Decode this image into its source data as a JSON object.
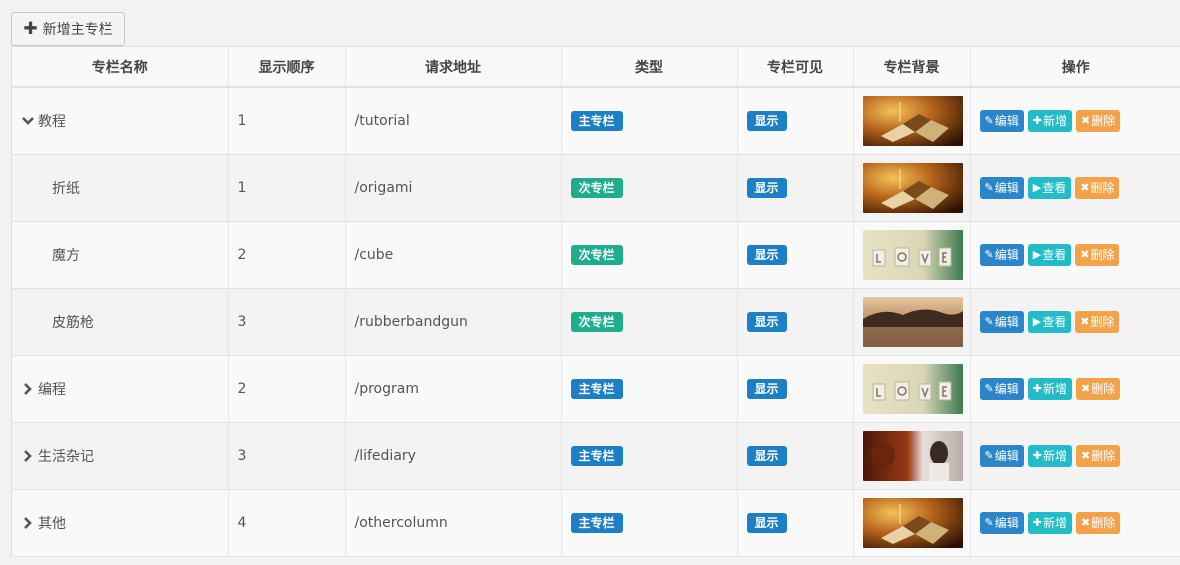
{
  "toolbar": {
    "add_main_label": "新增主专栏"
  },
  "columns": [
    "专栏名称",
    "显示顺序",
    "请求地址",
    "类型",
    "专栏可见",
    "专栏背景",
    "操作"
  ],
  "rows": [
    {
      "name": "教程",
      "order": "1",
      "url": "/tutorial",
      "type": "主专栏",
      "type_kind": "main",
      "visible": "显示",
      "bg": "book",
      "level": "parent",
      "caret": "down",
      "action2": "新增"
    },
    {
      "name": "折纸",
      "order": "1",
      "url": "/origami",
      "type": "次专栏",
      "type_kind": "sub",
      "visible": "显示",
      "bg": "book",
      "level": "child",
      "caret": "none",
      "action2": "查看"
    },
    {
      "name": "魔方",
      "order": "2",
      "url": "/cube",
      "type": "次专栏",
      "type_kind": "sub",
      "visible": "显示",
      "bg": "love",
      "level": "child",
      "caret": "none",
      "action2": "查看"
    },
    {
      "name": "皮筋枪",
      "order": "3",
      "url": "/rubberbandgun",
      "type": "次专栏",
      "type_kind": "sub",
      "visible": "显示",
      "bg": "lake",
      "level": "child",
      "caret": "none",
      "action2": "查看"
    },
    {
      "name": "编程",
      "order": "2",
      "url": "/program",
      "type": "主专栏",
      "type_kind": "main",
      "visible": "显示",
      "bg": "love",
      "level": "parent",
      "caret": "right",
      "action2": "新增"
    },
    {
      "name": "生活杂记",
      "order": "3",
      "url": "/lifediary",
      "type": "主专栏",
      "type_kind": "main",
      "visible": "显示",
      "bg": "portrait",
      "level": "parent",
      "caret": "right",
      "action2": "新增"
    },
    {
      "name": "其他",
      "order": "4",
      "url": "/othercolumn",
      "type": "主专栏",
      "type_kind": "main",
      "visible": "显示",
      "bg": "book",
      "level": "parent",
      "caret": "right",
      "action2": "新增"
    }
  ],
  "actions": {
    "edit": "编辑",
    "delete": "删除"
  },
  "colors": {
    "primary": "#1d7fc4",
    "success": "#1eae8e",
    "info": "#22bcc8",
    "warning": "#f4a24a"
  }
}
